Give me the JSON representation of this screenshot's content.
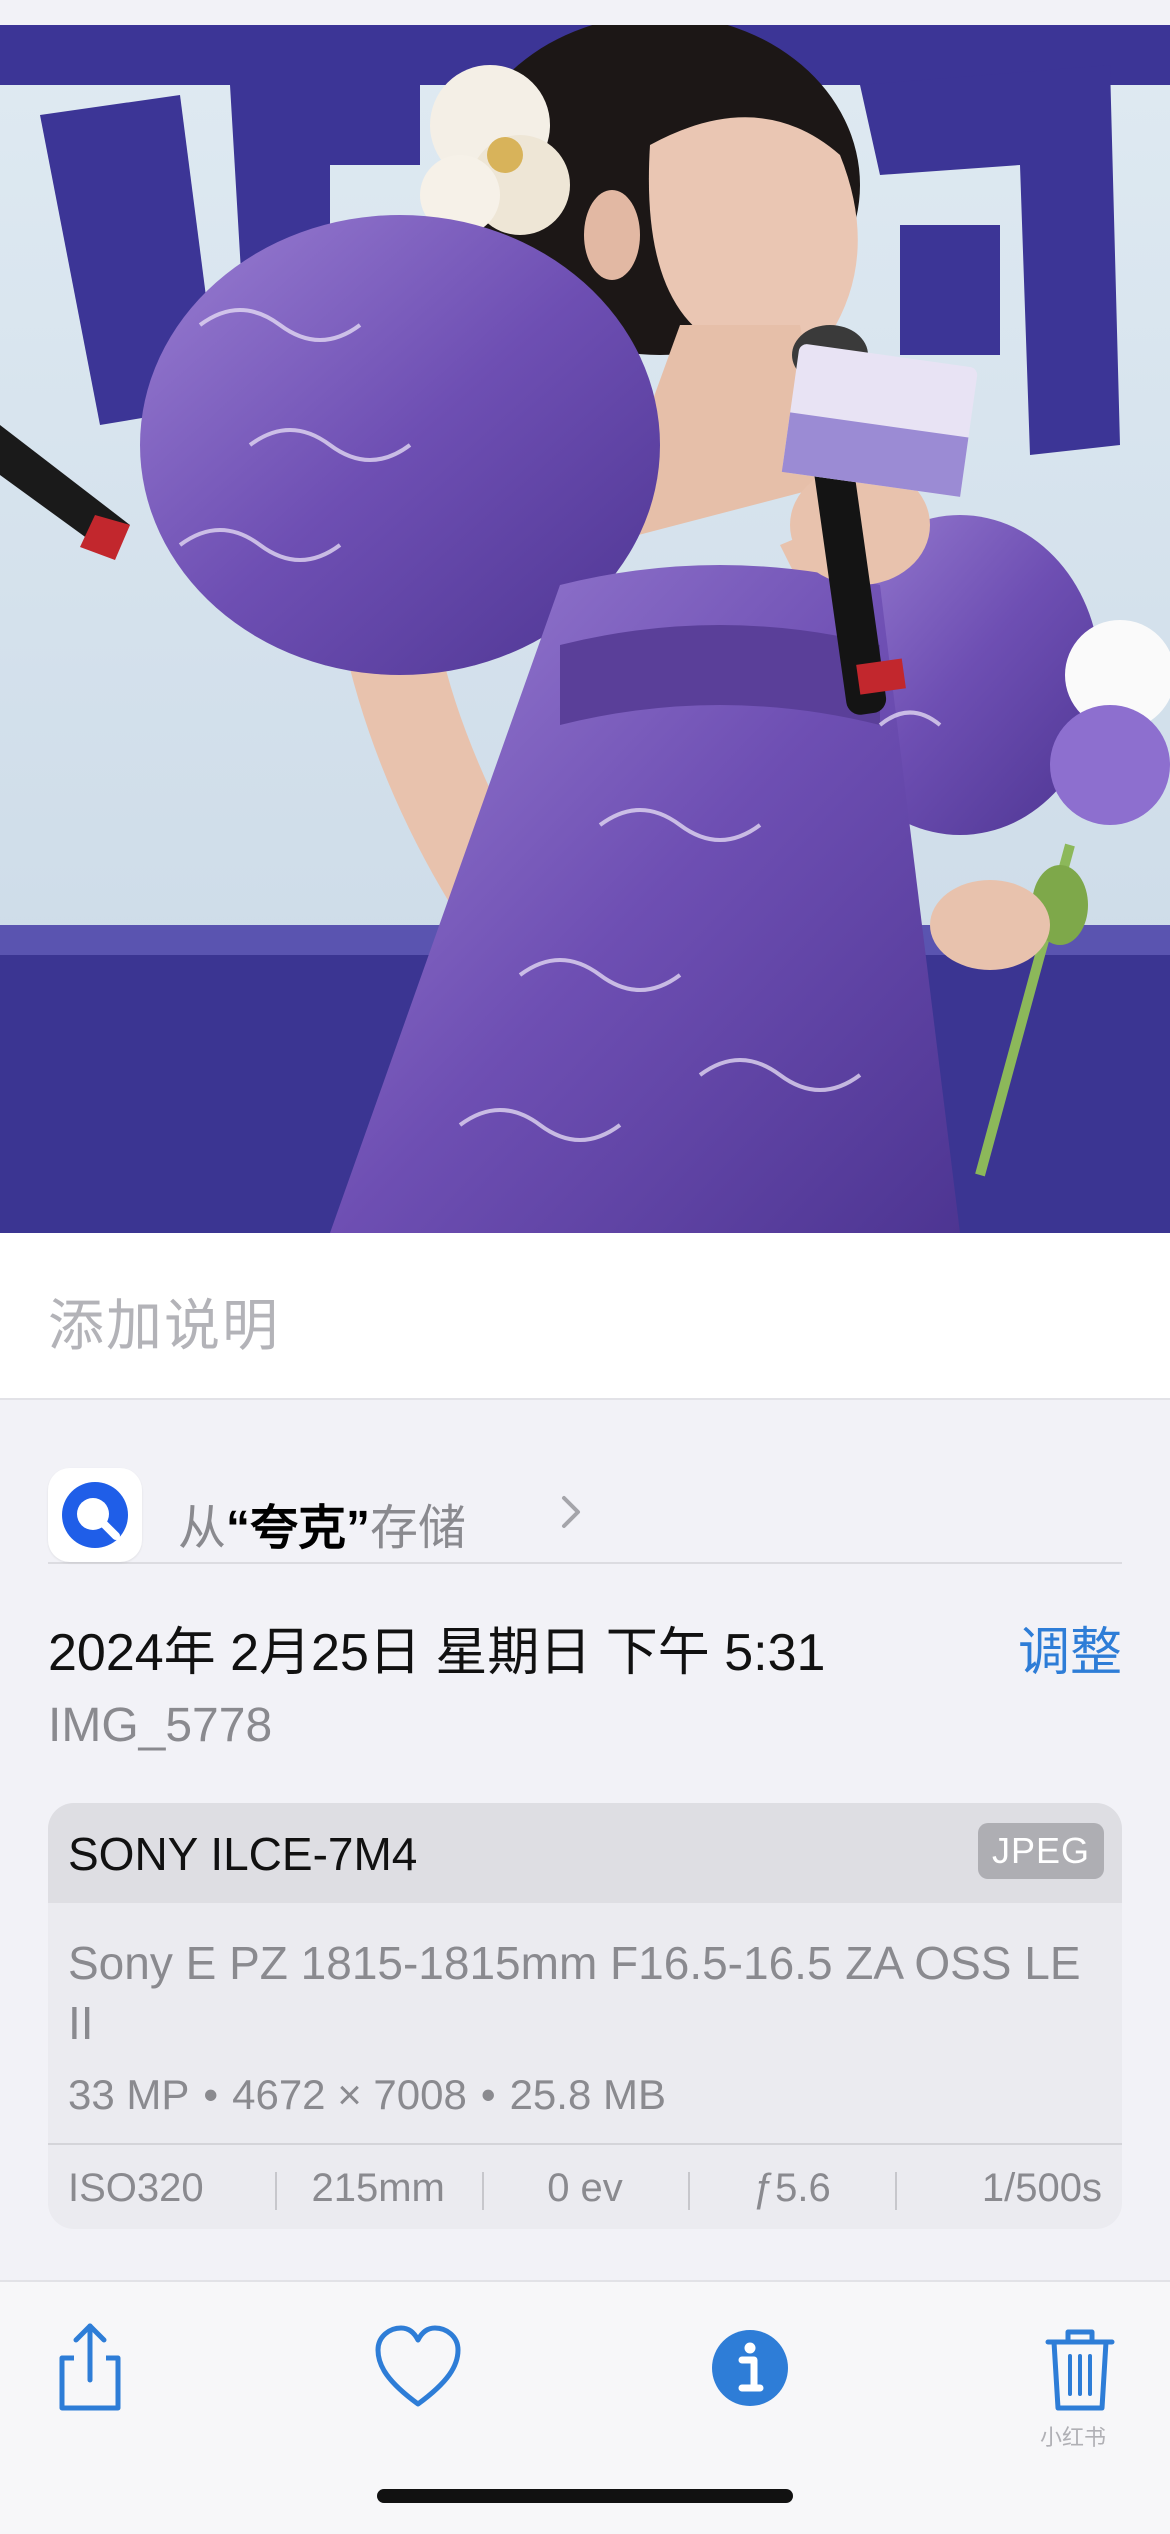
{
  "photo": {
    "subject": "photo-of-performer-in-purple-gown",
    "colors": {
      "backdrop": "#e3eef5",
      "banner": "#3c3596",
      "dress": "#7f5fbf",
      "dress_dark": "#5a3f99",
      "skin": "#eac6b3",
      "hair": "#1c1716"
    }
  },
  "caption": {
    "placeholder": "添加说明"
  },
  "source": {
    "prefix": "从",
    "app_name": "“夸克”",
    "suffix": "存储",
    "app_icon": "quark-app-icon"
  },
  "metadata": {
    "datetime": "2024年 2月25日 星期日 下午 5:31",
    "adjust_label": "调整",
    "filename": "IMG_5778"
  },
  "camera_card": {
    "camera": "SONY ILCE-7M4",
    "format_badge": "JPEG",
    "lens": "Sony E PZ 1815-1815mm F16.5-16.5 ZA OSS LE II",
    "megapixels": "33 MP",
    "resolution": "4672 × 7008",
    "filesize": "25.8 MB",
    "exif": [
      "ISO320",
      "215mm",
      "0 ev",
      "ƒ5.6",
      "1/500s"
    ]
  },
  "toolbar": {
    "items": [
      {
        "name": "share-icon"
      },
      {
        "name": "heart-icon"
      },
      {
        "name": "info-icon"
      },
      {
        "name": "trash-icon"
      }
    ],
    "accent": "#2e7dd7"
  },
  "watermark": "小红书"
}
